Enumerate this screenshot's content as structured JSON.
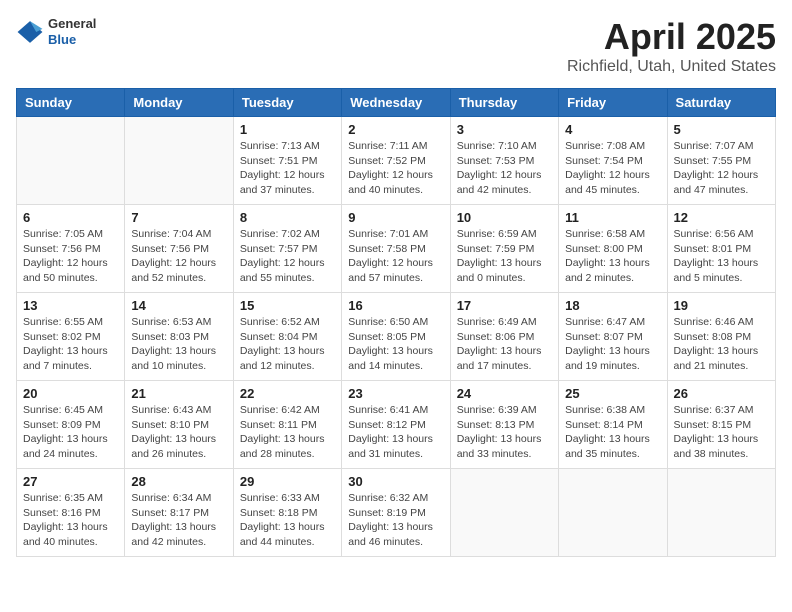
{
  "header": {
    "logo": {
      "general": "General",
      "blue": "Blue"
    },
    "title": "April 2025",
    "subtitle": "Richfield, Utah, United States"
  },
  "weekdays": [
    "Sunday",
    "Monday",
    "Tuesday",
    "Wednesday",
    "Thursday",
    "Friday",
    "Saturday"
  ],
  "weeks": [
    [
      {
        "day": "",
        "info": ""
      },
      {
        "day": "",
        "info": ""
      },
      {
        "day": "1",
        "info": "Sunrise: 7:13 AM\nSunset: 7:51 PM\nDaylight: 12 hours and 37 minutes."
      },
      {
        "day": "2",
        "info": "Sunrise: 7:11 AM\nSunset: 7:52 PM\nDaylight: 12 hours and 40 minutes."
      },
      {
        "day": "3",
        "info": "Sunrise: 7:10 AM\nSunset: 7:53 PM\nDaylight: 12 hours and 42 minutes."
      },
      {
        "day": "4",
        "info": "Sunrise: 7:08 AM\nSunset: 7:54 PM\nDaylight: 12 hours and 45 minutes."
      },
      {
        "day": "5",
        "info": "Sunrise: 7:07 AM\nSunset: 7:55 PM\nDaylight: 12 hours and 47 minutes."
      }
    ],
    [
      {
        "day": "6",
        "info": "Sunrise: 7:05 AM\nSunset: 7:56 PM\nDaylight: 12 hours and 50 minutes."
      },
      {
        "day": "7",
        "info": "Sunrise: 7:04 AM\nSunset: 7:56 PM\nDaylight: 12 hours and 52 minutes."
      },
      {
        "day": "8",
        "info": "Sunrise: 7:02 AM\nSunset: 7:57 PM\nDaylight: 12 hours and 55 minutes."
      },
      {
        "day": "9",
        "info": "Sunrise: 7:01 AM\nSunset: 7:58 PM\nDaylight: 12 hours and 57 minutes."
      },
      {
        "day": "10",
        "info": "Sunrise: 6:59 AM\nSunset: 7:59 PM\nDaylight: 13 hours and 0 minutes."
      },
      {
        "day": "11",
        "info": "Sunrise: 6:58 AM\nSunset: 8:00 PM\nDaylight: 13 hours and 2 minutes."
      },
      {
        "day": "12",
        "info": "Sunrise: 6:56 AM\nSunset: 8:01 PM\nDaylight: 13 hours and 5 minutes."
      }
    ],
    [
      {
        "day": "13",
        "info": "Sunrise: 6:55 AM\nSunset: 8:02 PM\nDaylight: 13 hours and 7 minutes."
      },
      {
        "day": "14",
        "info": "Sunrise: 6:53 AM\nSunset: 8:03 PM\nDaylight: 13 hours and 10 minutes."
      },
      {
        "day": "15",
        "info": "Sunrise: 6:52 AM\nSunset: 8:04 PM\nDaylight: 13 hours and 12 minutes."
      },
      {
        "day": "16",
        "info": "Sunrise: 6:50 AM\nSunset: 8:05 PM\nDaylight: 13 hours and 14 minutes."
      },
      {
        "day": "17",
        "info": "Sunrise: 6:49 AM\nSunset: 8:06 PM\nDaylight: 13 hours and 17 minutes."
      },
      {
        "day": "18",
        "info": "Sunrise: 6:47 AM\nSunset: 8:07 PM\nDaylight: 13 hours and 19 minutes."
      },
      {
        "day": "19",
        "info": "Sunrise: 6:46 AM\nSunset: 8:08 PM\nDaylight: 13 hours and 21 minutes."
      }
    ],
    [
      {
        "day": "20",
        "info": "Sunrise: 6:45 AM\nSunset: 8:09 PM\nDaylight: 13 hours and 24 minutes."
      },
      {
        "day": "21",
        "info": "Sunrise: 6:43 AM\nSunset: 8:10 PM\nDaylight: 13 hours and 26 minutes."
      },
      {
        "day": "22",
        "info": "Sunrise: 6:42 AM\nSunset: 8:11 PM\nDaylight: 13 hours and 28 minutes."
      },
      {
        "day": "23",
        "info": "Sunrise: 6:41 AM\nSunset: 8:12 PM\nDaylight: 13 hours and 31 minutes."
      },
      {
        "day": "24",
        "info": "Sunrise: 6:39 AM\nSunset: 8:13 PM\nDaylight: 13 hours and 33 minutes."
      },
      {
        "day": "25",
        "info": "Sunrise: 6:38 AM\nSunset: 8:14 PM\nDaylight: 13 hours and 35 minutes."
      },
      {
        "day": "26",
        "info": "Sunrise: 6:37 AM\nSunset: 8:15 PM\nDaylight: 13 hours and 38 minutes."
      }
    ],
    [
      {
        "day": "27",
        "info": "Sunrise: 6:35 AM\nSunset: 8:16 PM\nDaylight: 13 hours and 40 minutes."
      },
      {
        "day": "28",
        "info": "Sunrise: 6:34 AM\nSunset: 8:17 PM\nDaylight: 13 hours and 42 minutes."
      },
      {
        "day": "29",
        "info": "Sunrise: 6:33 AM\nSunset: 8:18 PM\nDaylight: 13 hours and 44 minutes."
      },
      {
        "day": "30",
        "info": "Sunrise: 6:32 AM\nSunset: 8:19 PM\nDaylight: 13 hours and 46 minutes."
      },
      {
        "day": "",
        "info": ""
      },
      {
        "day": "",
        "info": ""
      },
      {
        "day": "",
        "info": ""
      }
    ]
  ]
}
